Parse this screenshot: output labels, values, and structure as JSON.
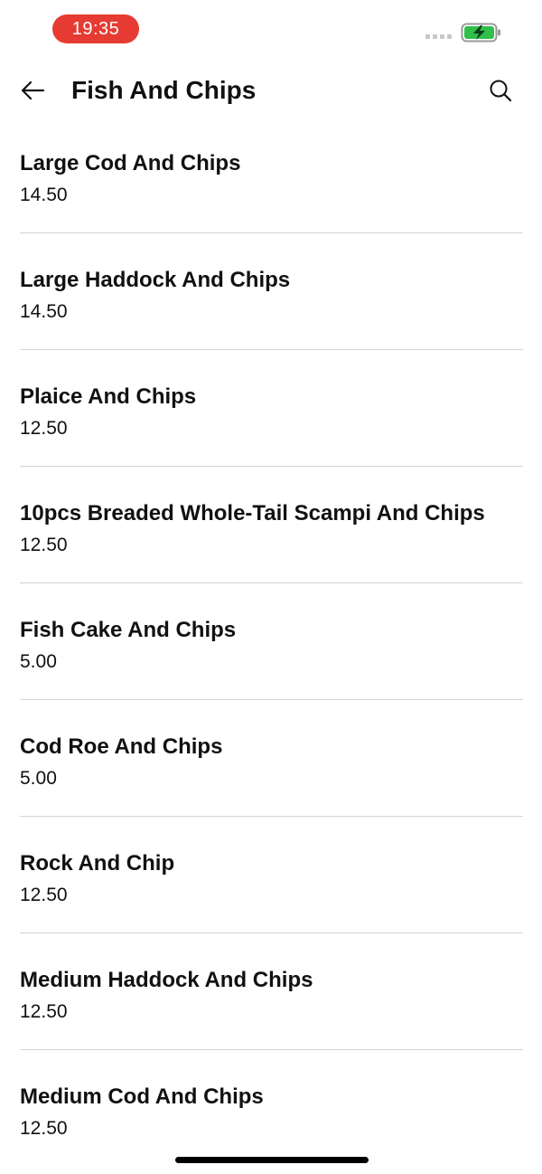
{
  "status_bar": {
    "time": "19:35",
    "time_pill_color": "#e63b33",
    "battery_color": "#2fbf4a"
  },
  "header": {
    "title": "Fish And Chips",
    "back_icon": "arrow-left-icon",
    "search_icon": "search-icon"
  },
  "menu": {
    "items": [
      {
        "name": "Large Cod And Chips",
        "price": "14.50"
      },
      {
        "name": "Large Haddock And Chips",
        "price": "14.50"
      },
      {
        "name": "Plaice And Chips",
        "price": "12.50"
      },
      {
        "name": "10pcs Breaded Whole-Tail Scampi And Chips",
        "price": "12.50"
      },
      {
        "name": "Fish Cake And Chips",
        "price": "5.00"
      },
      {
        "name": "Cod Roe And Chips",
        "price": "5.00"
      },
      {
        "name": "Rock And Chip",
        "price": "12.50"
      },
      {
        "name": "Medium Haddock And Chips",
        "price": "12.50"
      },
      {
        "name": "Medium Cod And Chips",
        "price": "12.50"
      }
    ]
  }
}
